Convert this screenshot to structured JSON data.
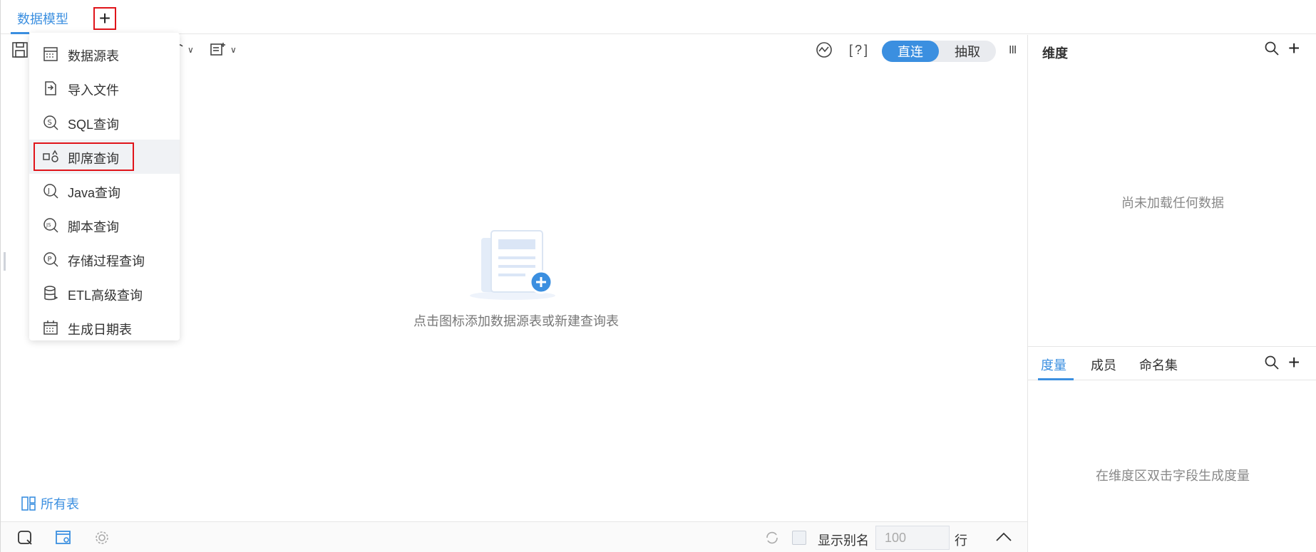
{
  "tabbar": {
    "active_tab": "数据模型",
    "add_icon": "plus-icon"
  },
  "toolbar": {
    "mode_direct": "直连",
    "mode_extract": "抽取",
    "help_label": "[?]",
    "column_icon": "III"
  },
  "dropdown": {
    "items": [
      {
        "label": "数据源表",
        "icon": "table-icon"
      },
      {
        "label": "导入文件",
        "icon": "import-file-icon"
      },
      {
        "label": "SQL查询",
        "icon": "sql-query-icon"
      },
      {
        "label": "即席查询",
        "icon": "adhoc-query-icon"
      },
      {
        "label": "Java查询",
        "icon": "java-query-icon"
      },
      {
        "label": "脚本查询",
        "icon": "script-query-icon"
      },
      {
        "label": "存储过程查询",
        "icon": "procedure-query-icon"
      },
      {
        "label": "ETL高级查询",
        "icon": "etl-query-icon"
      },
      {
        "label": "生成日期表",
        "icon": "calendar-icon"
      }
    ]
  },
  "canvas": {
    "empty_text": "点击图标添加数据源表或新建查询表",
    "all_tables": "所有表"
  },
  "bottombar": {
    "show_alias": "显示别名",
    "row_count": "100",
    "row_unit": "行"
  },
  "rpanel": {
    "dimension_title": "维度",
    "dimension_empty": "尚未加载任何数据",
    "tabs": [
      "度量",
      "成员",
      "命名集"
    ],
    "measure_empty": "在维度区双击字段生成度量"
  },
  "colors": {
    "accent": "#3b8fe0",
    "highlight_border": "#e0141a"
  }
}
